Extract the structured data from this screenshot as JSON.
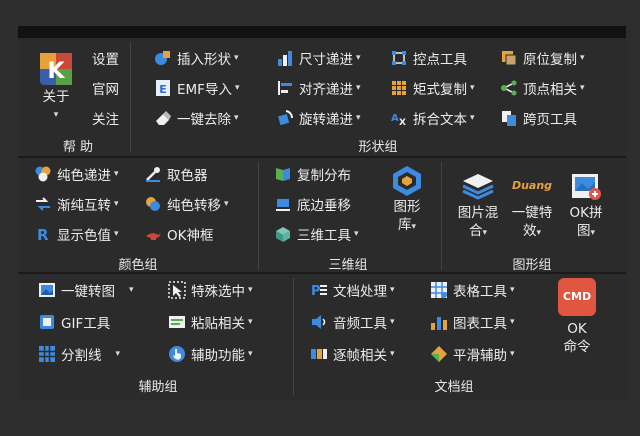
{
  "help_group": {
    "label": "帮 助",
    "about_label": "关于",
    "settings_label": "设置",
    "website_label": "官网",
    "follow_label": "关注"
  },
  "shape_group": {
    "label": "形状组",
    "items": [
      {
        "label": "插入形状"
      },
      {
        "label": "尺寸递进"
      },
      {
        "label": "控点工具"
      },
      {
        "label": "原位复制"
      },
      {
        "label": "EMF导入"
      },
      {
        "label": "对齐递进"
      },
      {
        "label": "矩式复制"
      },
      {
        "label": "顶点相关"
      },
      {
        "label": "一键去除"
      },
      {
        "label": "旋转递进"
      },
      {
        "label": "拆合文本"
      },
      {
        "label": "跨页工具"
      }
    ]
  },
  "color_group": {
    "label": "颜色组",
    "items": [
      {
        "label": "纯色递进"
      },
      {
        "label": "取色器"
      },
      {
        "label": "渐纯互转"
      },
      {
        "label": "纯色转移"
      },
      {
        "label": "显示色值"
      },
      {
        "label": "OK神框"
      }
    ]
  },
  "threed_group": {
    "label": "三维组",
    "copy_distribute": "复制分布",
    "bottom_vertical": "底边垂移",
    "threed_tools": "三维工具",
    "shape_lib_line1": "图形",
    "shape_lib_line2": "库"
  },
  "graphic_group": {
    "label": "图形组",
    "mix_line1": "图片混",
    "mix_line2": "合",
    "effect_line1": "一键特",
    "effect_line2": "效",
    "effect_logo": "Duang",
    "stitch_line1": "OK拼",
    "stitch_line2": "图"
  },
  "assist_group": {
    "label": "辅助组",
    "items": [
      {
        "label": "一键转图"
      },
      {
        "label": "特殊选中"
      },
      {
        "label": "GIF工具"
      },
      {
        "label": "粘贴相关"
      },
      {
        "label": "分割线"
      },
      {
        "label": "辅助功能"
      }
    ]
  },
  "doc_group": {
    "label": "文档组",
    "items": [
      {
        "label": "文档处理"
      },
      {
        "label": "表格工具"
      },
      {
        "label": "音频工具"
      },
      {
        "label": "图表工具"
      },
      {
        "label": "逐帧相关"
      },
      {
        "label": "平滑辅助"
      }
    ],
    "cmd_badge": "CMD",
    "cmd_line1": "OK",
    "cmd_line2": "命令"
  },
  "dropdown_caret": "▾"
}
